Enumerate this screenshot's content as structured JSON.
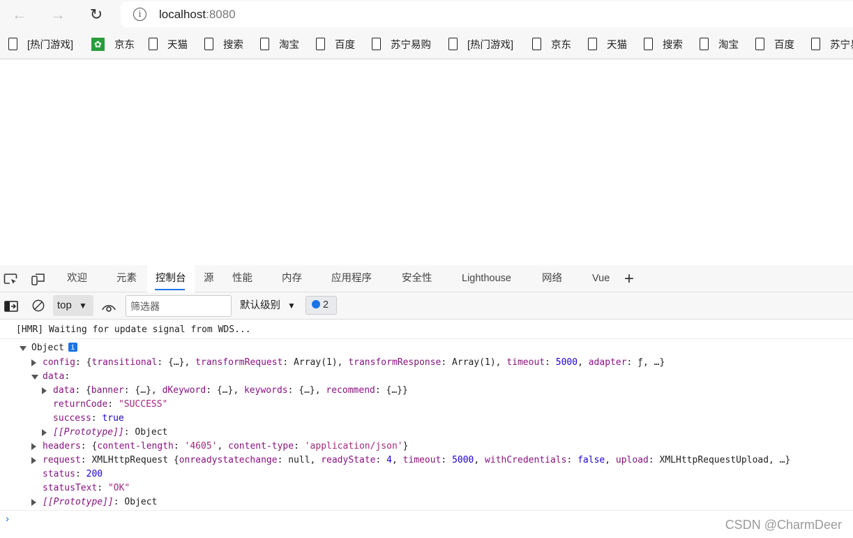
{
  "browser": {
    "url_host": "localhost",
    "url_port": ":8080",
    "bookmarks": [
      {
        "label": "[热门游戏]",
        "icon": "page-icon"
      },
      {
        "label": "京东",
        "icon": "jd-icon"
      },
      {
        "label": "天猫",
        "icon": "page-icon"
      },
      {
        "label": "搜索",
        "icon": "page-icon"
      },
      {
        "label": "淘宝",
        "icon": "page-icon"
      },
      {
        "label": "百度",
        "icon": "page-icon"
      },
      {
        "label": "苏宁易购",
        "icon": "page-icon"
      },
      {
        "label": "[热门游戏]",
        "icon": "page-icon"
      },
      {
        "label": "京东",
        "icon": "page-icon"
      },
      {
        "label": "天猫",
        "icon": "page-icon"
      },
      {
        "label": "搜索",
        "icon": "page-icon"
      },
      {
        "label": "淘宝",
        "icon": "page-icon"
      },
      {
        "label": "百度",
        "icon": "page-icon"
      },
      {
        "label": "苏宁易购",
        "icon": "page-icon"
      }
    ]
  },
  "devtools": {
    "tabs": [
      "欢迎",
      "元素",
      "控制台",
      "源",
      "性能",
      "内存",
      "应用程序",
      "安全性",
      "Lighthouse",
      "网络",
      "Vue"
    ],
    "active_tab": "控制台",
    "toolbar": {
      "context": "top",
      "filter_placeholder": "筛选器",
      "level": "默认级别",
      "issues_count": "2"
    },
    "accent": "#1a73e8"
  },
  "console": {
    "lines": [
      {
        "indent": 0,
        "toggle": "none",
        "segs": [
          [
            "[HMR] Waiting for update signal from WDS...",
            "p"
          ]
        ]
      },
      {
        "indent": 1,
        "toggle": "d",
        "info": "i",
        "segs": [
          [
            "Object",
            "p"
          ]
        ]
      },
      {
        "indent": 2,
        "toggle": "r",
        "segs": [
          [
            "config",
            "k"
          ],
          [
            ": {",
            "p"
          ],
          [
            "transitional",
            "k"
          ],
          [
            ": {…}, ",
            "p"
          ],
          [
            "transformRequest",
            "k"
          ],
          [
            ": Array(1), ",
            "p"
          ],
          [
            "transformResponse",
            "k"
          ],
          [
            ": Array(1), ",
            "p"
          ],
          [
            "timeout",
            "k"
          ],
          [
            ": ",
            "p"
          ],
          [
            "5000",
            "n"
          ],
          [
            ", ",
            "p"
          ],
          [
            "adapter",
            "k"
          ],
          [
            ": ƒ, …}",
            "p"
          ]
        ]
      },
      {
        "indent": 2,
        "toggle": "d",
        "segs": [
          [
            "data",
            "k"
          ],
          [
            ":",
            "p"
          ]
        ]
      },
      {
        "indent": 3,
        "toggle": "r",
        "segs": [
          [
            "data",
            "k"
          ],
          [
            ": {",
            "p"
          ],
          [
            "banner",
            "k"
          ],
          [
            ": {…}, ",
            "p"
          ],
          [
            "dKeyword",
            "k"
          ],
          [
            ": {…}, ",
            "p"
          ],
          [
            "keywords",
            "k"
          ],
          [
            ": {…}, ",
            "p"
          ],
          [
            "recommend",
            "k"
          ],
          [
            ": {…}}",
            "p"
          ]
        ]
      },
      {
        "indent": 3,
        "toggle": "none",
        "segs": [
          [
            "returnCode",
            "k"
          ],
          [
            ": ",
            "p"
          ],
          [
            "\"SUCCESS\"",
            "s"
          ]
        ]
      },
      {
        "indent": 3,
        "toggle": "none",
        "segs": [
          [
            "success",
            "k"
          ],
          [
            ": ",
            "p"
          ],
          [
            "true",
            "n"
          ]
        ]
      },
      {
        "indent": 3,
        "toggle": "r",
        "segs": [
          [
            "[[Prototype]]",
            "i"
          ],
          [
            ": Object",
            "p"
          ]
        ]
      },
      {
        "indent": 2,
        "toggle": "r",
        "segs": [
          [
            "headers",
            "k"
          ],
          [
            ": {",
            "p"
          ],
          [
            "content-length",
            "k"
          ],
          [
            ": ",
            "p"
          ],
          [
            "'4605'",
            "s"
          ],
          [
            ", ",
            "p"
          ],
          [
            "content-type",
            "k"
          ],
          [
            ": ",
            "p"
          ],
          [
            "'application/json'",
            "s"
          ],
          [
            "}",
            "p"
          ]
        ]
      },
      {
        "indent": 2,
        "toggle": "r",
        "segs": [
          [
            "request",
            "k"
          ],
          [
            ": XMLHttpRequest {",
            "p"
          ],
          [
            "onreadystatechange",
            "k"
          ],
          [
            ": null, ",
            "p"
          ],
          [
            "readyState",
            "k"
          ],
          [
            ": ",
            "p"
          ],
          [
            "4",
            "n"
          ],
          [
            ", ",
            "p"
          ],
          [
            "timeout",
            "k"
          ],
          [
            ": ",
            "p"
          ],
          [
            "5000",
            "n"
          ],
          [
            ", ",
            "p"
          ],
          [
            "withCredentials",
            "k"
          ],
          [
            ": ",
            "p"
          ],
          [
            "false",
            "n"
          ],
          [
            ", ",
            "p"
          ],
          [
            "upload",
            "k"
          ],
          [
            ": XMLHttpRequestUpload, …}",
            "p"
          ]
        ]
      },
      {
        "indent": 2,
        "toggle": "none",
        "segs": [
          [
            "status",
            "k"
          ],
          [
            ": ",
            "p"
          ],
          [
            "200",
            "n"
          ]
        ]
      },
      {
        "indent": 2,
        "toggle": "none",
        "segs": [
          [
            "statusText",
            "k"
          ],
          [
            ": ",
            "p"
          ],
          [
            "\"OK\"",
            "s"
          ]
        ]
      },
      {
        "indent": 2,
        "toggle": "r",
        "segs": [
          [
            "[[Prototype]]",
            "i"
          ],
          [
            ": Object",
            "p"
          ]
        ]
      }
    ],
    "prompt": "›"
  },
  "watermark": "CSDN @CharmDeer"
}
